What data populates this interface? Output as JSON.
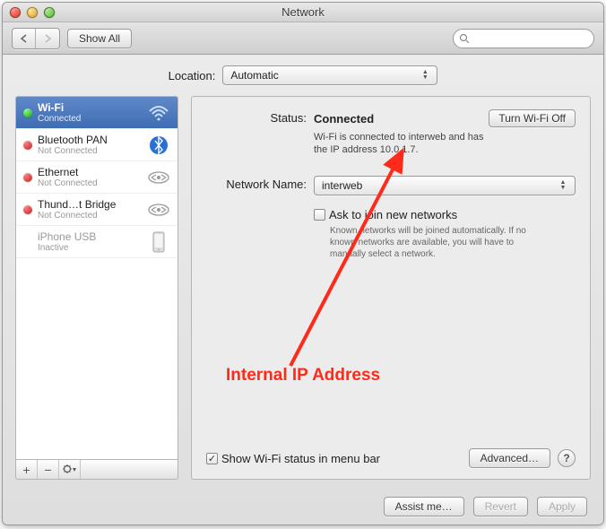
{
  "window_title": "Network",
  "toolbar": {
    "show_all": "Show All",
    "search_placeholder": ""
  },
  "location": {
    "label": "Location:",
    "value": "Automatic"
  },
  "sidebar": {
    "items": [
      {
        "name": "Wi-Fi",
        "status": "Connected",
        "dot": "green",
        "icon": "wifi"
      },
      {
        "name": "Bluetooth PAN",
        "status": "Not Connected",
        "dot": "red",
        "icon": "bluetooth"
      },
      {
        "name": "Ethernet",
        "status": "Not Connected",
        "dot": "red",
        "icon": "ethernet"
      },
      {
        "name": "Thund…t Bridge",
        "status": "Not Connected",
        "dot": "red",
        "icon": "ethernet"
      },
      {
        "name": "iPhone USB",
        "status": "Inactive",
        "dot": "gray",
        "icon": "iphone"
      }
    ]
  },
  "main": {
    "status_label": "Status:",
    "status_value": "Connected",
    "turn_off": "Turn Wi-Fi Off",
    "status_desc": "Wi-Fi is connected to interweb and has the IP address 10.0.1.7.",
    "network_name_label": "Network Name:",
    "network_name_value": "interweb",
    "ask_join": "Ask to join new networks",
    "ask_join_desc": "Known networks will be joined automatically. If no known networks are available, you will have to manually select a network.",
    "show_status": "Show Wi-Fi status in menu bar",
    "advanced": "Advanced…"
  },
  "footer": {
    "assist": "Assist me…",
    "revert": "Revert",
    "apply": "Apply"
  },
  "annotation": {
    "text": "Internal IP Address"
  }
}
